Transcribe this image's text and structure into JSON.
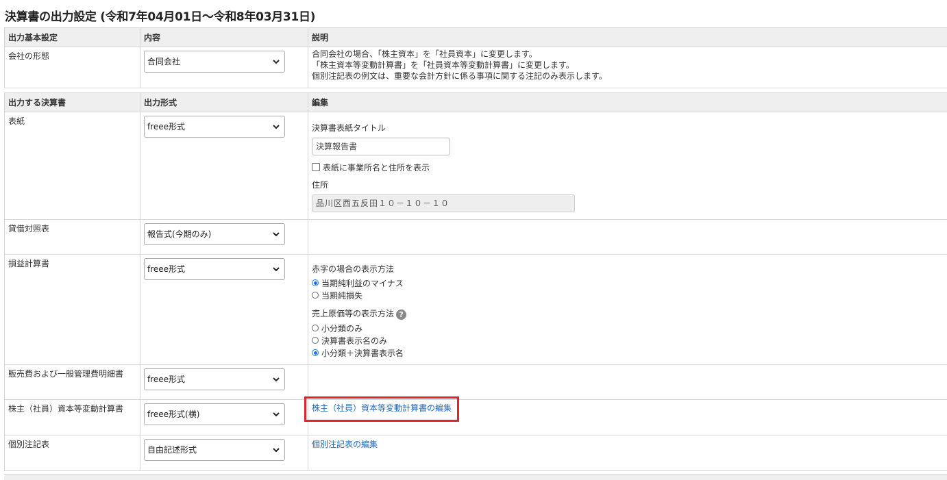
{
  "page": {
    "title": "決算書の出力設定 (令和7年04月01日～令和8年03月31日)"
  },
  "basic": {
    "headers": {
      "col1": "出力基本設定",
      "col2": "内容",
      "col3": "説明"
    },
    "company_type_label": "会社の形態",
    "company_type_value": "合同会社",
    "desc": [
      "合同会社の場合、「株主資本」を「社員資本」に変更します。",
      "「株主資本等変動計算書」を「社員資本等変動計算書」に変更します。",
      "個別注記表の例文は、重要な会計方針に係る事項に関する注記のみ表示します。"
    ]
  },
  "statements": {
    "headers": {
      "col1": "出力する決算書",
      "col2": "出力形式",
      "col3": "編集"
    },
    "cover": {
      "label": "表紙",
      "format": "freee形式",
      "title_label": "決算書表紙タイトル",
      "title_value": "決算報告書",
      "show_address_label": "表紙に事業所名と住所を表示",
      "address_label": "住所",
      "address_value": "品川区西五反田１０－１０－１０"
    },
    "balance_sheet": {
      "label": "貸借対照表",
      "format": "報告式(今期のみ)"
    },
    "income_statement": {
      "label": "損益計算書",
      "format": "freee形式",
      "deficit_label": "赤字の場合の表示方法",
      "deficit_options": [
        "当期純利益のマイナス",
        "当期純損失"
      ],
      "deficit_selected": 0,
      "cogs_label": "売上原価等の表示方法",
      "cogs_options": [
        "小分類のみ",
        "決算書表示名のみ",
        "小分類＋決算書表示名"
      ],
      "cogs_selected": 2
    },
    "sga": {
      "label": "販売費および一般管理費明細書",
      "format": "freee形式"
    },
    "equity": {
      "label": "株主（社員）資本等変動計算書",
      "format": "freee形式(横)",
      "edit_link": "株主（社員）資本等変動計算書の編集"
    },
    "notes": {
      "label": "個別注記表",
      "format": "自由記述形式",
      "edit_link": "個別注記表の編集"
    }
  },
  "colors": {
    "accent_link": "#2268b6",
    "highlight_border": "#e0242c",
    "radio_selected": "#1a73e8"
  },
  "icons": {
    "select": "chevron-down-icon",
    "help": "help-icon"
  }
}
